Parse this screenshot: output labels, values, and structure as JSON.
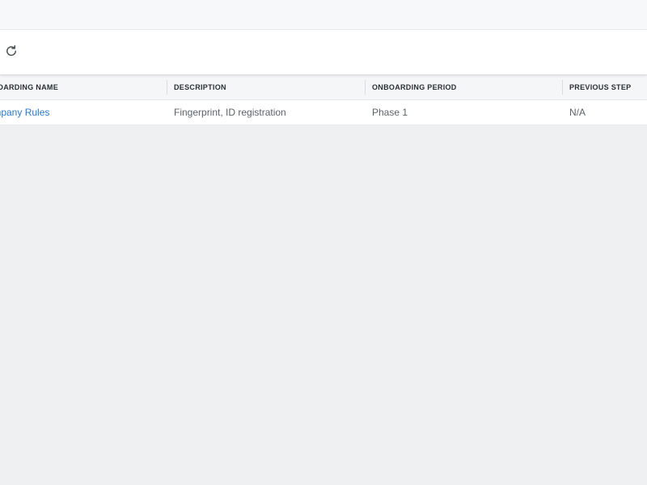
{
  "toolbar": {
    "refresh_icon": "refresh-icon"
  },
  "grid": {
    "columns": [
      "ONBOARDING NAME",
      "DESCRIPTION",
      "ONBOARDING PERIOD",
      "PREVIOUS STEP"
    ],
    "rows": [
      {
        "name": "Company Rules",
        "description": "Fingerprint, ID registration",
        "period": "Phase 1",
        "previous_step": "N/A"
      }
    ]
  },
  "colors": {
    "background": "#eef0f2",
    "link": "#2a7ac7",
    "header_text": "#2b2f33",
    "cell_text": "#5d636a"
  }
}
